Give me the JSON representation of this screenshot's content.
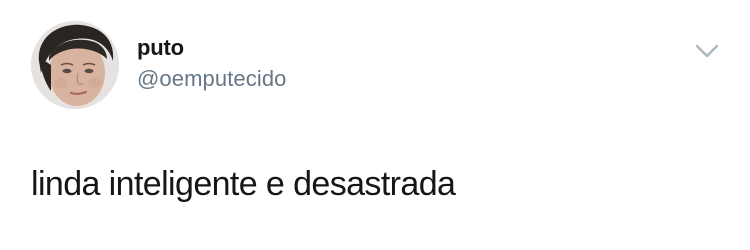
{
  "tweet": {
    "author": {
      "display_name": "puto",
      "handle": "@oemputecido",
      "avatar_icon": "profile-photo"
    },
    "menu_icon": "chevron-down-icon",
    "text": "linda inteligente e desastrada"
  },
  "colors": {
    "text_primary": "#14171a",
    "text_secondary": "#657786",
    "caret": "#aab8c2",
    "background": "#ffffff"
  }
}
